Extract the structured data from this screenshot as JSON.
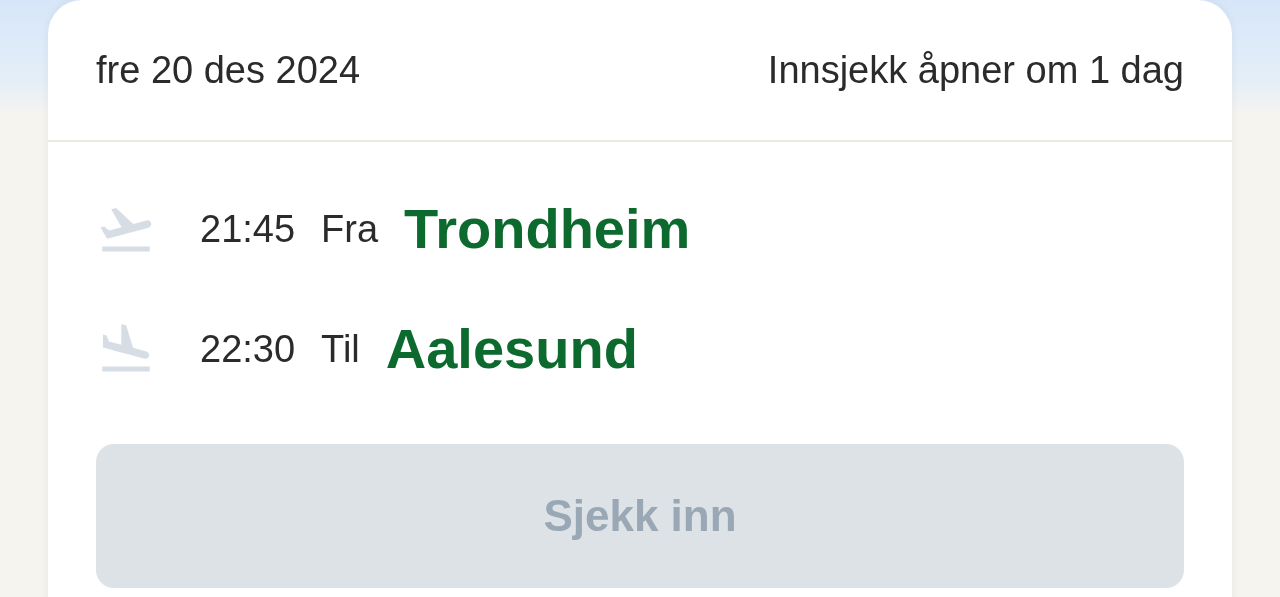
{
  "header": {
    "date": "fre 20 des 2024",
    "checkin_status": "Innsjekk åpner om 1 dag"
  },
  "flights": [
    {
      "kind": "departure",
      "time": "21:45",
      "label": "Fra",
      "city": "Trondheim"
    },
    {
      "kind": "arrival",
      "time": "22:30",
      "label": "Til",
      "city": "Aalesund"
    }
  ],
  "checkin_button": {
    "label": "Sjekk inn",
    "disabled": true
  }
}
